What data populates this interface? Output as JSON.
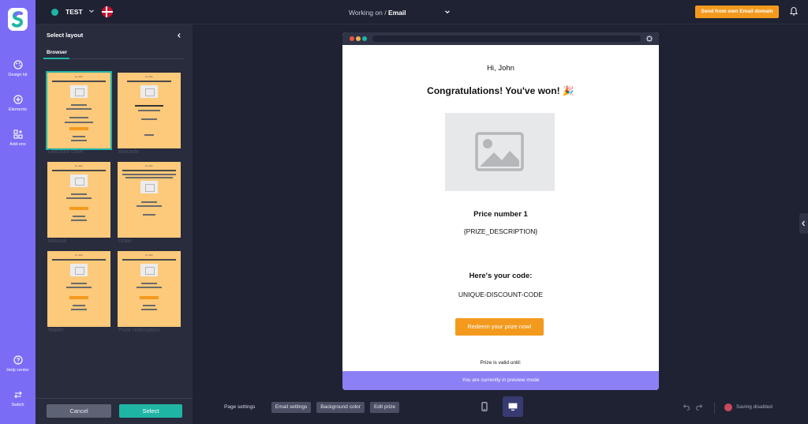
{
  "rail": {
    "items": [
      {
        "label": "Design kit",
        "icon": "palette-icon"
      },
      {
        "label": "Elements",
        "icon": "plus-circle-icon"
      },
      {
        "label": "Add-ons",
        "icon": "add-ons-icon"
      },
      {
        "label": "Help center",
        "icon": "help-icon"
      },
      {
        "label": "Switch",
        "icon": "switch-icon"
      }
    ]
  },
  "topbar": {
    "environment": "TEST",
    "working_prefix": "Working on  /",
    "working_on": "Email",
    "send_button": "Send from own Email domain"
  },
  "panel": {
    "title": "Select layout",
    "tab": "Browser",
    "layouts": [
      {
        "label": "Discount code",
        "selected": true
      },
      {
        "label": "Barcode",
        "selected": false
      },
      {
        "label": "Manual",
        "selected": false
      },
      {
        "label": "Draw",
        "selected": false
      },
      {
        "label": "Wallet",
        "selected": false
      },
      {
        "label": "Prize redemption",
        "selected": false
      }
    ],
    "thumb_title_1": "Congratulations! You've won!",
    "thumb_title_2": "Prize number 1",
    "cancel_label": "Cancel",
    "select_label": "Select"
  },
  "email": {
    "greeting": "Hi, John",
    "headline": "Congratulations! You've won! 🎉",
    "prize_title": "Price number 1",
    "prize_description": "{PRIZE_DESCRIPTION}",
    "code_title": "Here's your code:",
    "code": "UNIQUE-DISCOUNT-CODE",
    "redeem_button": "Redeem your prize now!",
    "valid_until": "Prize is valid until:",
    "preview_notice": "You are currently in preview mode"
  },
  "toolbar": {
    "page_settings": "Page settings",
    "email_settings": "Email settings",
    "background_color": "Background color",
    "edit_prize": "Edit prize",
    "saving_status": "Saving disabled"
  },
  "colors": {
    "accent": "#1fb5a5",
    "rail": "#7b6cf6",
    "orange": "#f39a1e",
    "card": "#fdc97a",
    "preview_bar": "#8b80f5"
  }
}
